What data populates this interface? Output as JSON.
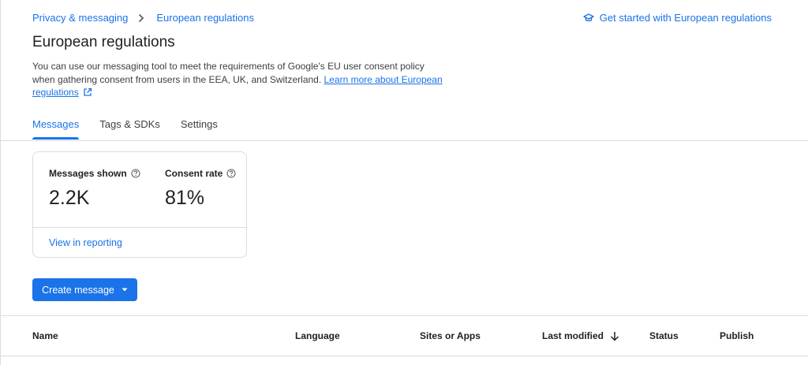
{
  "breadcrumb": {
    "parent": "Privacy & messaging",
    "current": "European regulations"
  },
  "get_started": {
    "label": "Get started with European regulations",
    "icon": "graduation-cap-icon"
  },
  "page": {
    "title": "European regulations",
    "description": "You can use our messaging tool to meet the requirements of Google's EU user consent policy when gathering consent from users in the EEA, UK, and Switzerland.",
    "learn_more": "Learn more about European regulations"
  },
  "tabs": [
    {
      "label": "Messages",
      "active": true
    },
    {
      "label": "Tags & SDKs",
      "active": false
    },
    {
      "label": "Settings",
      "active": false
    }
  ],
  "stats": {
    "messages_shown": {
      "label": "Messages shown",
      "value": "2.2K"
    },
    "consent_rate": {
      "label": "Consent rate",
      "value": "81%"
    },
    "view_link": "View in reporting"
  },
  "create_button": {
    "label": "Create message"
  },
  "table": {
    "columns": [
      "Name",
      "Language",
      "Sites or Apps",
      "Last modified",
      "Status",
      "Publish"
    ],
    "sort_column": "Last modified",
    "sort_direction": "descending"
  },
  "colors": {
    "accent": "#1a73e8",
    "text": "#202124",
    "divider": "#dadce0"
  }
}
